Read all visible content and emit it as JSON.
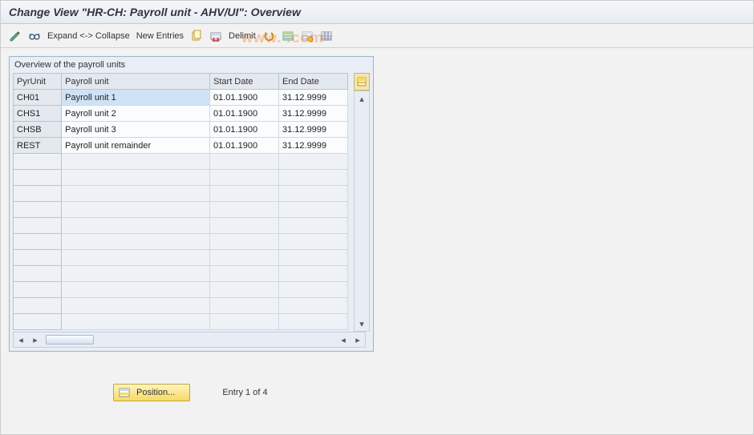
{
  "title": "Change View \"HR-CH: Payroll unit - AHV/UI\": Overview",
  "toolbar": {
    "expand": "Expand <-> Collapse",
    "new_entries": "New Entries",
    "delimit": "Delimit"
  },
  "panel": {
    "title": "Overview of the payroll units",
    "columns": {
      "pyrunit": "PyrUnit",
      "payroll_unit": "Payroll unit",
      "start_date": "Start Date",
      "end_date": "End Date"
    },
    "rows": [
      {
        "pyrunit": "CH01",
        "payroll_unit": "Payroll unit 1",
        "start_date": "01.01.1900",
        "end_date": "31.12.9999",
        "selected": true
      },
      {
        "pyrunit": "CHS1",
        "payroll_unit": "Payroll unit 2",
        "start_date": "01.01.1900",
        "end_date": "31.12.9999",
        "selected": false
      },
      {
        "pyrunit": "CHSB",
        "payroll_unit": "Payroll unit 3",
        "start_date": "01.01.1900",
        "end_date": "31.12.9999",
        "selected": false
      },
      {
        "pyrunit": "REST",
        "payroll_unit": "Payroll unit remainder",
        "start_date": "01.01.1900",
        "end_date": "31.12.9999",
        "selected": false
      }
    ],
    "empty_rows": 11
  },
  "footer": {
    "position_label": "Position...",
    "entry_text": "Entry 1 of 4"
  },
  "watermark": "www. .com"
}
